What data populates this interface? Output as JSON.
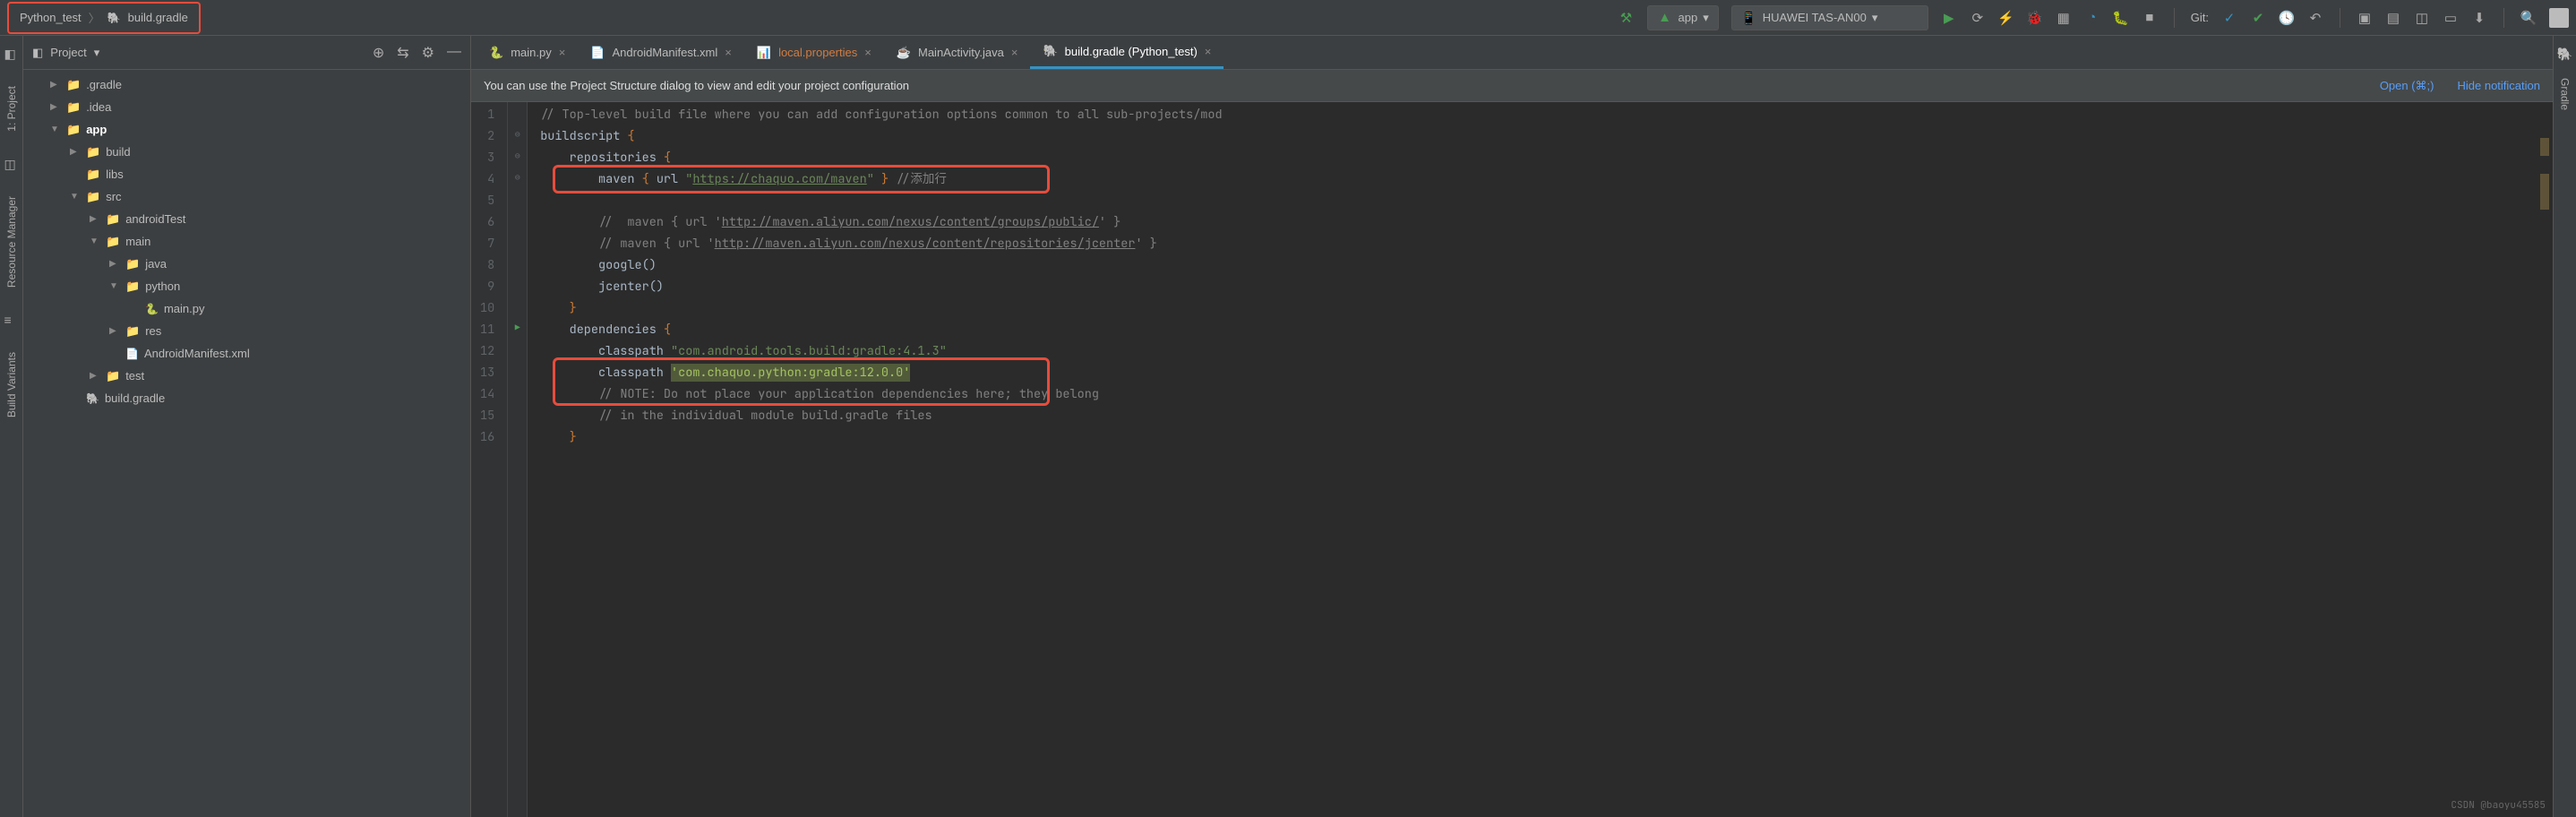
{
  "breadcrumb": {
    "project": "Python_test",
    "file": "build.gradle"
  },
  "run_configs": {
    "app": "app",
    "device": "HUAWEI TAS-AN00"
  },
  "git_label": "Git:",
  "project_panel": {
    "title": "Project"
  },
  "tree": [
    {
      "indent": 1,
      "arrow": "▶",
      "icon": "folder",
      "iconClass": "orange",
      "label": ".gradle"
    },
    {
      "indent": 1,
      "arrow": "▶",
      "icon": "folder",
      "iconClass": "",
      "label": ".idea"
    },
    {
      "indent": 1,
      "arrow": "▼",
      "icon": "folder",
      "iconClass": "",
      "label": "app",
      "bold": true
    },
    {
      "indent": 2,
      "arrow": "▶",
      "icon": "folder",
      "iconClass": "orange",
      "label": "build"
    },
    {
      "indent": 2,
      "arrow": "",
      "icon": "folder",
      "iconClass": "",
      "label": "libs"
    },
    {
      "indent": 2,
      "arrow": "▼",
      "icon": "folder",
      "iconClass": "",
      "label": "src"
    },
    {
      "indent": 3,
      "arrow": "▶",
      "icon": "folder",
      "iconClass": "",
      "label": "androidTest"
    },
    {
      "indent": 3,
      "arrow": "▼",
      "icon": "folder",
      "iconClass": "",
      "label": "main"
    },
    {
      "indent": 4,
      "arrow": "▶",
      "icon": "folder",
      "iconClass": "blue",
      "label": "java"
    },
    {
      "indent": 4,
      "arrow": "▼",
      "icon": "folder",
      "iconClass": "blue",
      "label": "python"
    },
    {
      "indent": 5,
      "arrow": "",
      "icon": "file",
      "iconClass": "py",
      "label": "main.py"
    },
    {
      "indent": 4,
      "arrow": "▶",
      "icon": "folder",
      "iconClass": "",
      "label": "res"
    },
    {
      "indent": 4,
      "arrow": "",
      "icon": "file",
      "iconClass": "xml",
      "label": "AndroidManifest.xml"
    },
    {
      "indent": 3,
      "arrow": "▶",
      "icon": "folder",
      "iconClass": "",
      "label": "test"
    },
    {
      "indent": 2,
      "arrow": "",
      "icon": "file",
      "iconClass": "gradle",
      "label": "build.gradle"
    }
  ],
  "tabs": [
    {
      "label": "main.py",
      "icon": "py",
      "active": false
    },
    {
      "label": "AndroidManifest.xml",
      "icon": "xml",
      "active": false
    },
    {
      "label": "local.properties",
      "icon": "prop",
      "active": false,
      "warn": true
    },
    {
      "label": "MainActivity.java",
      "icon": "java",
      "active": false
    },
    {
      "label": "build.gradle (Python_test)",
      "icon": "gradle",
      "active": true
    }
  ],
  "banner": {
    "text": "You can use the Project Structure dialog to view and edit your project configuration",
    "link1": "Open (⌘;)",
    "link2": "Hide notification"
  },
  "code": {
    "lines": [
      {
        "n": 1,
        "html": "<span class='cmt'>// Top-level build file where you can add configuration options common to all sub-projects/mod</span>"
      },
      {
        "n": 2,
        "html": "buildscript <span class='kw'>{</span>"
      },
      {
        "n": 3,
        "html": "    repositories <span class='kw'>{</span>"
      },
      {
        "n": 4,
        "html": "        maven <span class='kw'>{</span> url <span class='str'>\"</span><span class='str-url'>https://chaquo.com/maven</span><span class='str'>\"</span> <span class='kw'>}</span> <span class='cmt'>//添加行</span>"
      },
      {
        "n": 5,
        "html": ""
      },
      {
        "n": 6,
        "html": "        <span class='cmt'>//  maven { url '</span><span class='cmt-url'>http://maven.aliyun.com/nexus/content/groups/public/</span><span class='cmt'>' }</span>"
      },
      {
        "n": 7,
        "html": "        <span class='cmt'>// maven { url '</span><span class='cmt-url'>http://maven.aliyun.com/nexus/content/repositories/jcenter</span><span class='cmt'>' }</span>"
      },
      {
        "n": 8,
        "html": "        google()"
      },
      {
        "n": 9,
        "html": "        jcenter()"
      },
      {
        "n": 10,
        "html": "    <span class='kw'>}</span>"
      },
      {
        "n": 11,
        "html": "    dependencies <span class='kw'>{</span>"
      },
      {
        "n": 12,
        "html": "        classpath <span class='str'>\"com.android.tools.build:gradle:4.1.3\"</span>"
      },
      {
        "n": 13,
        "html": "        classpath <span class='hl-bg'>'com.chaquo.python:gradle:12.0.0'</span>"
      },
      {
        "n": 14,
        "html": "        <span class='cmt'>// NOTE: Do not place your application dependencies here; they belong</span>"
      },
      {
        "n": 15,
        "html": "        <span class='cmt'>// in the individual module build.gradle files</span>"
      },
      {
        "n": 16,
        "html": "    <span class='kw'>}</span>"
      }
    ]
  },
  "left_sidebar": {
    "item1": "1: Project",
    "item2": "Resource Manager",
    "item3": "Build Variants"
  },
  "right_sidebar": {
    "item1": "Gradle"
  },
  "watermark": "CSDN @baoyu45585"
}
